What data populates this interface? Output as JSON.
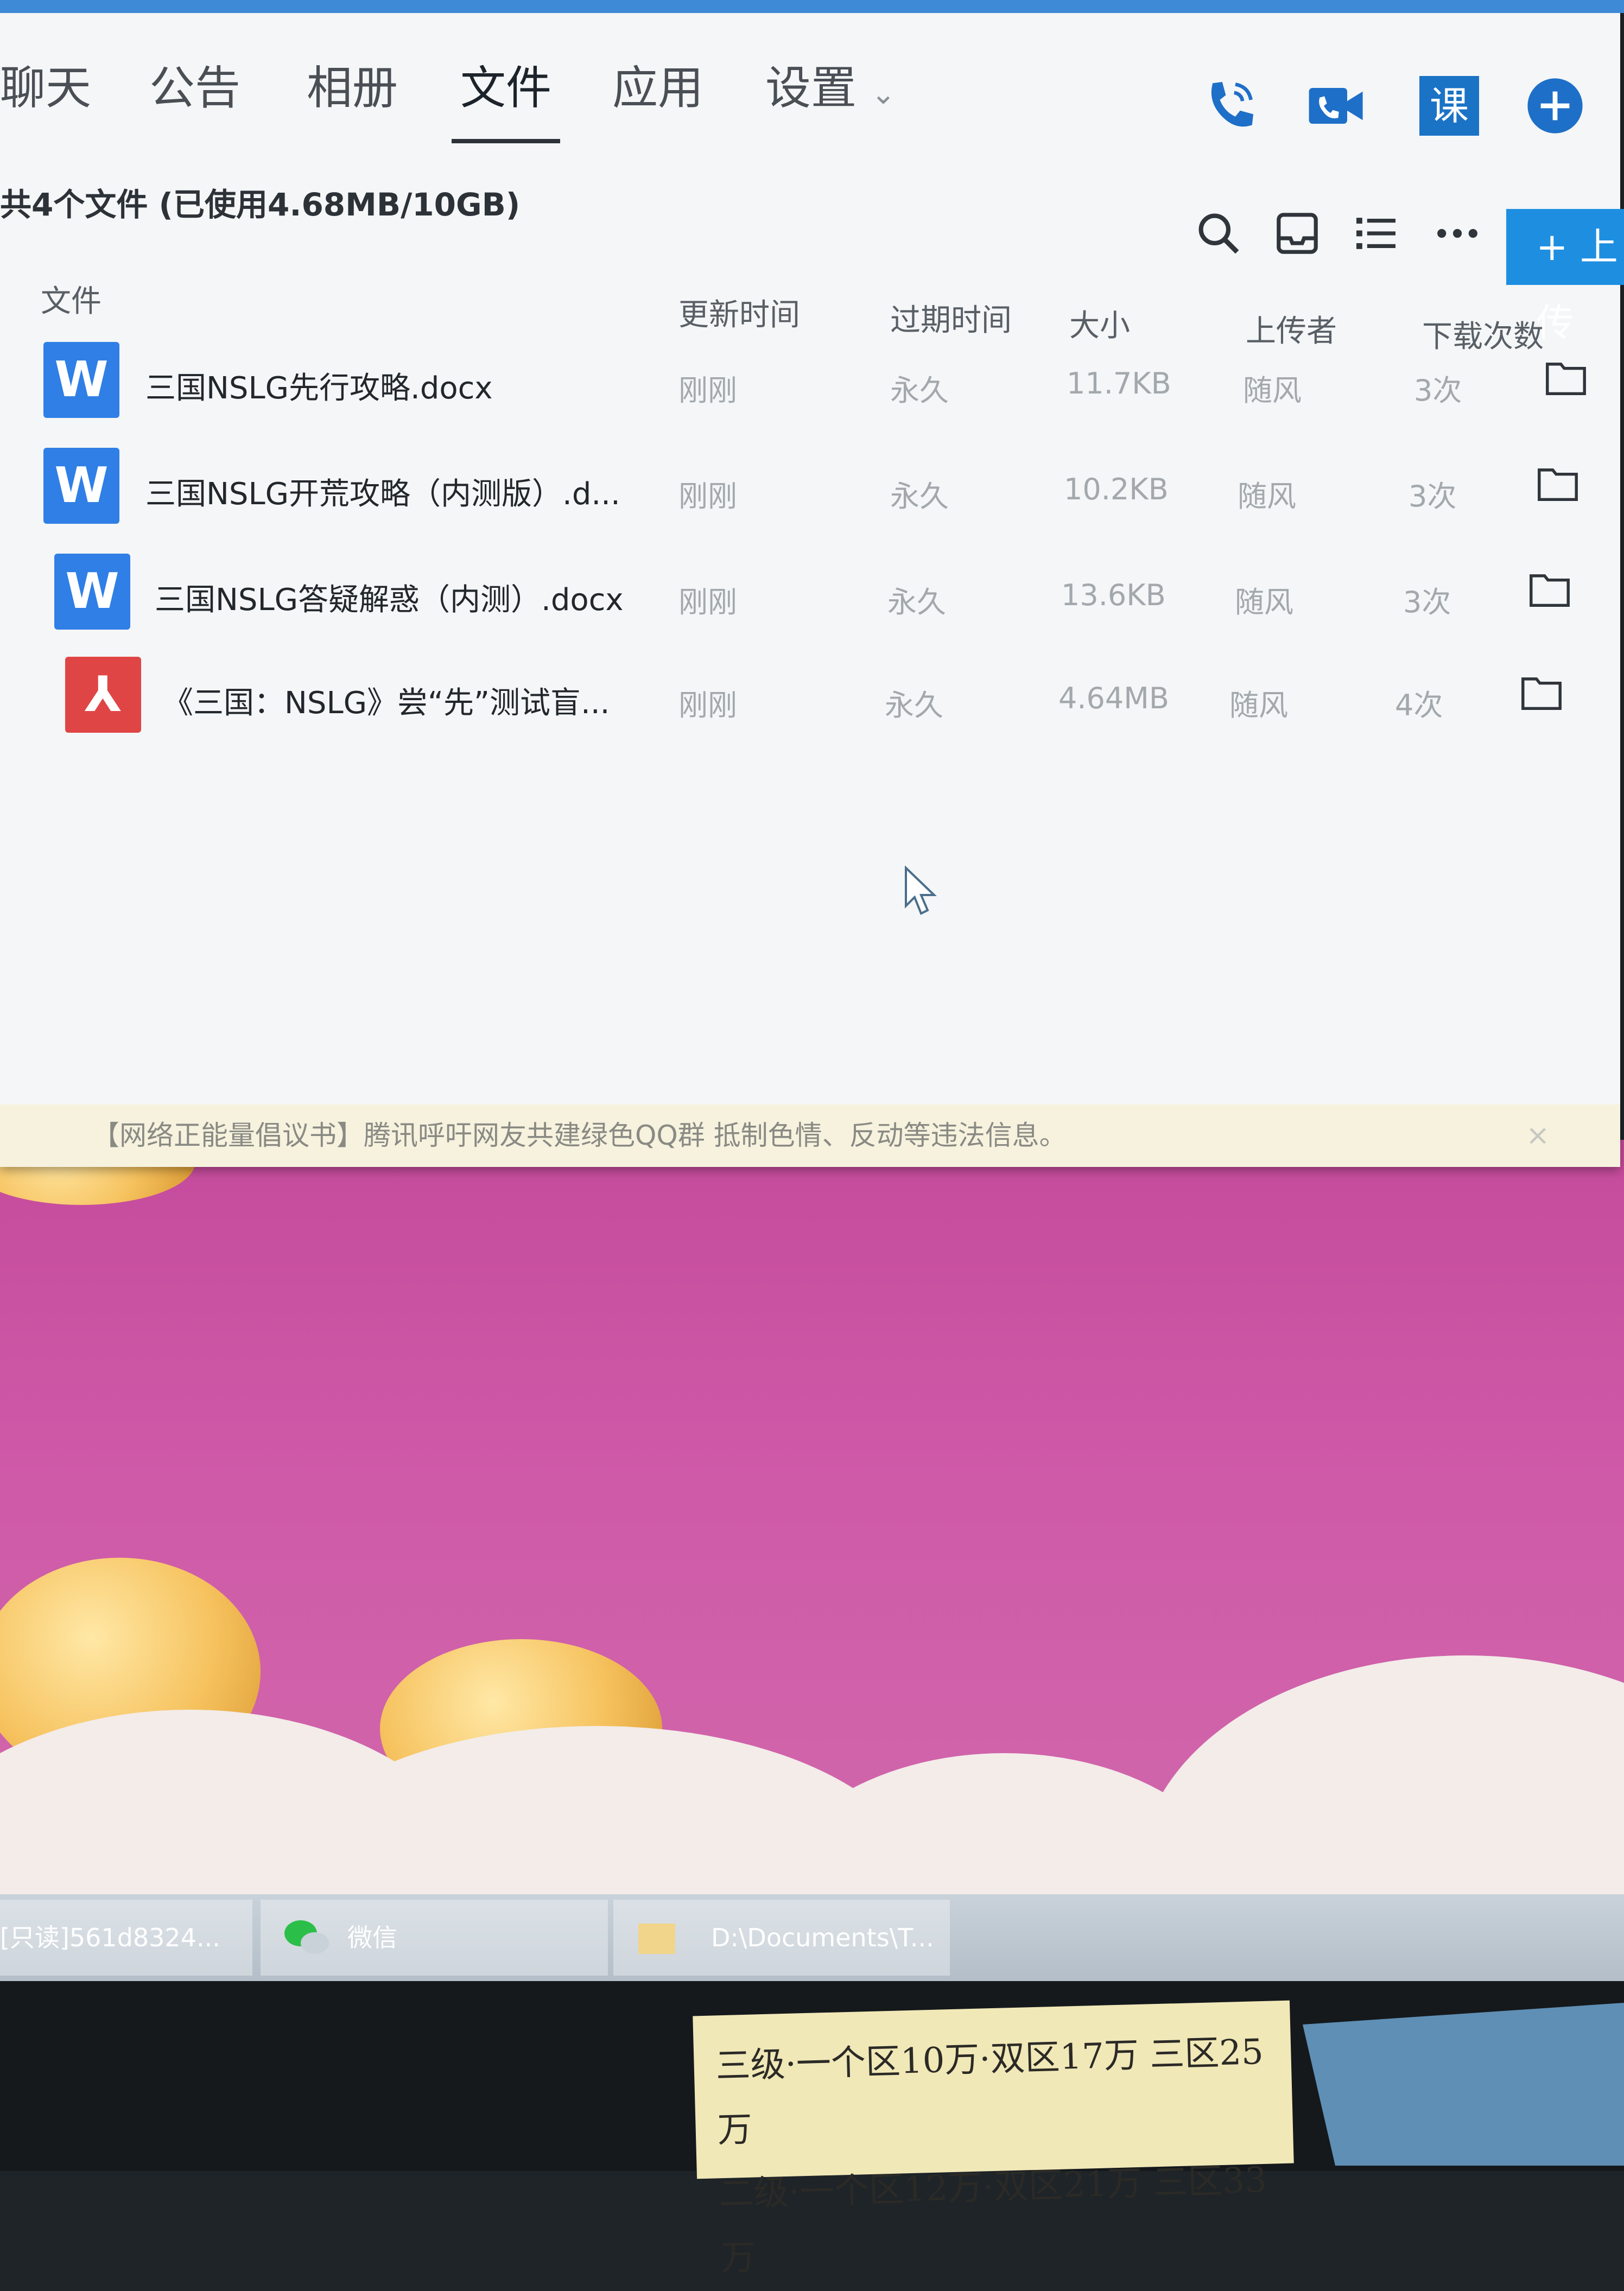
{
  "nav": {
    "tabs": [
      {
        "label": "聊天"
      },
      {
        "label": "公告"
      },
      {
        "label": "相册"
      },
      {
        "label": "文件"
      },
      {
        "label": "应用"
      },
      {
        "label": "设置"
      }
    ],
    "active_tab": "文件",
    "settings_chevron": "⌄",
    "icons": [
      "phone-icon",
      "video-call-icon",
      "class-icon",
      "add-icon"
    ],
    "class_icon_text": "课"
  },
  "files": {
    "summary": "共4个文件 (已使用4.68MB/10GB)",
    "upload_label": "+ 上传",
    "toolbar_icons": [
      "search-icon",
      "inbox-icon",
      "list-view-icon",
      "more-icon"
    ],
    "columns": {
      "name": "文件",
      "updated": "更新时间",
      "expires": "过期时间",
      "size": "大小",
      "uploader": "上传者",
      "downloads": "下载次数"
    },
    "rows": [
      {
        "type": "word",
        "icon_text": "W",
        "name": "三国NSLG先行攻略.docx",
        "updated": "刚刚",
        "expires": "永久",
        "size": "11.7KB",
        "uploader": "随风",
        "downloads": "3次"
      },
      {
        "type": "word",
        "icon_text": "W",
        "name": "三国NSLG开荒攻略（内测版）.d...",
        "updated": "刚刚",
        "expires": "永久",
        "size": "10.2KB",
        "uploader": "随风",
        "downloads": "3次"
      },
      {
        "type": "word",
        "icon_text": "W",
        "name": "三国NSLG答疑解惑（内测）.docx",
        "updated": "刚刚",
        "expires": "永久",
        "size": "13.6KB",
        "uploader": "随风",
        "downloads": "3次"
      },
      {
        "type": "pdf",
        "icon_text": "⅄",
        "name": "《三国：NSLG》尝“先”测试盲...",
        "updated": "刚刚",
        "expires": "永久",
        "size": "4.64MB",
        "uploader": "随风",
        "downloads": "4次"
      }
    ]
  },
  "notice": {
    "text": "【网络正能量倡议书】腾讯呼吁网友共建绿色QQ群 抵制色情、反动等违法信息。",
    "close": "×"
  },
  "taskbar": {
    "items": [
      {
        "label": "[只读]561d8324..."
      },
      {
        "label": "微信"
      },
      {
        "label": "D:\\Documents\\T..."
      }
    ]
  },
  "sticky_note": {
    "line1": "三级·一个区10万·双区17万 三区25万",
    "line2": "二级·一个区12万·双区21万 三区33万"
  },
  "colors": {
    "accent": "#1e8fe0",
    "word_icon": "#2f7fe6",
    "pdf_icon": "#e04545",
    "wallpaper": "#c54b9c"
  }
}
